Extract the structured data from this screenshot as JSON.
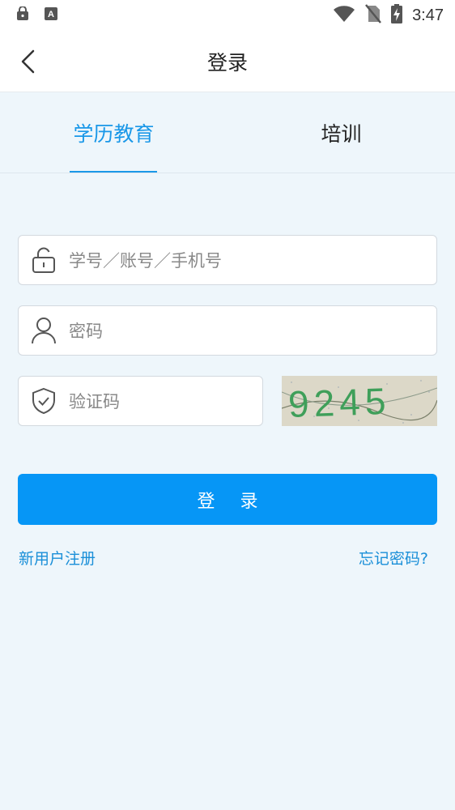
{
  "status_bar": {
    "time": "3:47"
  },
  "header": {
    "title": "登录"
  },
  "tabs": [
    {
      "label": "学历教育",
      "active": true
    },
    {
      "label": "培训",
      "active": false
    }
  ],
  "form": {
    "account_placeholder": "学号／账号／手机号",
    "password_placeholder": "密码",
    "captcha_placeholder": "验证码",
    "captcha_text": "9245",
    "login_label": "登 录"
  },
  "links": {
    "register": "新用户注册",
    "forgot": "忘记密码?"
  },
  "colors": {
    "accent": "#1a98e8",
    "button": "#0696f6",
    "background": "#eef6fb"
  }
}
